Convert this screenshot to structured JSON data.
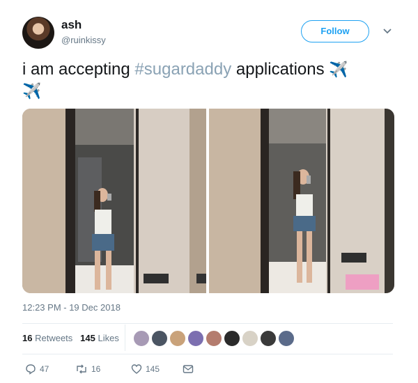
{
  "user": {
    "name": "ash",
    "handle": "@ruinkissy"
  },
  "follow_button": "Follow",
  "tweet": {
    "text_before": "i am accepting ",
    "hashtag": "#sugardaddy",
    "text_after": " applications ",
    "emoji": "✈️",
    "emoji2": "✈️"
  },
  "timestamp": "12:23 PM - 19 Dec 2018",
  "stats": {
    "retweets_count": "16",
    "retweets_label": "Retweets",
    "likes_count": "145",
    "likes_label": "Likes"
  },
  "likers": [
    "#a79ab5",
    "#4b5563",
    "#c9a27a",
    "#7c6fb0",
    "#b47c6e",
    "#2b2b2b",
    "#d8d2c6",
    "#3a3a3a",
    "#5b6b8a"
  ],
  "actions": {
    "replies": "47",
    "retweets": "16",
    "likes": "145"
  },
  "colors": {
    "accent": "#1da1f2",
    "muted": "#657786",
    "hashtag": "#8aa2b4"
  }
}
